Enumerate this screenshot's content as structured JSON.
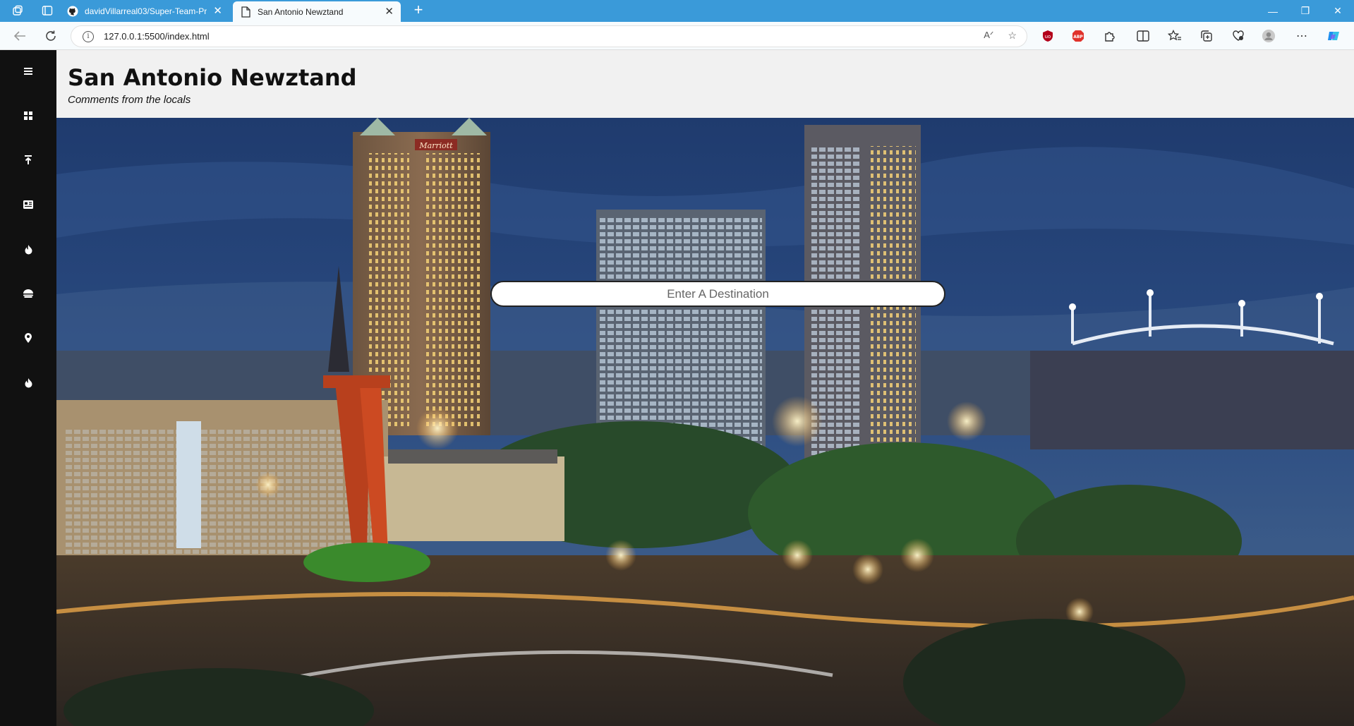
{
  "browser": {
    "tabs": [
      {
        "title": "davidVillarreal03/Super-Team-Pr",
        "icon": "github-icon",
        "active": false
      },
      {
        "title": "San Antonio Newztand",
        "icon": "page-icon",
        "active": true
      }
    ],
    "url": "127.0.0.1:5500/index.html"
  },
  "header": {
    "title": "San Antonio Newztand",
    "subtitle": "Comments from the locals"
  },
  "sidebar": {
    "items": [
      {
        "icon": "menu-icon"
      },
      {
        "icon": "grid-icon"
      },
      {
        "icon": "upload-icon"
      },
      {
        "icon": "newspaper-icon"
      },
      {
        "icon": "fire-icon"
      },
      {
        "icon": "food-icon"
      },
      {
        "icon": "map-pin-icon"
      },
      {
        "icon": "fire-icon"
      }
    ]
  },
  "search": {
    "placeholder": "Enter A Destination"
  },
  "hotel_sign": "Marriott",
  "colors": {
    "tabbar": "#3a9ad9",
    "sidebar": "#111111",
    "header_bg": "#f1f1f1",
    "sky": "#2b4c82"
  }
}
